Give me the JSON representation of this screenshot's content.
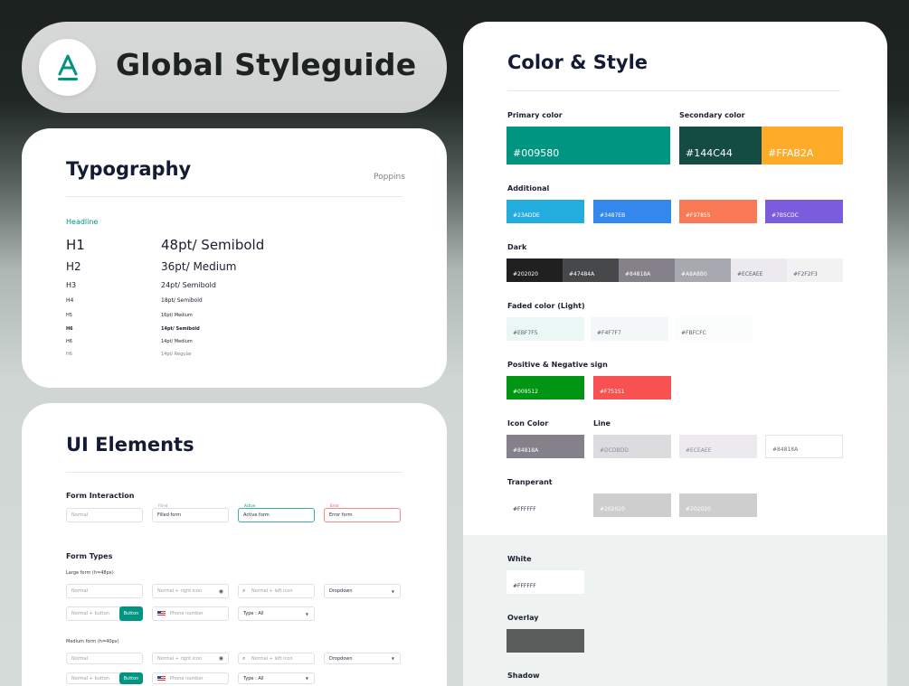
{
  "header": {
    "title": "Global Styleguide",
    "logo_icon": "a-logo-icon",
    "brand_color": "#009580"
  },
  "typography": {
    "title": "Typography",
    "font_name": "Poppins",
    "section_label": "Headline",
    "rows": [
      {
        "tag": "H1",
        "value": "48pt/ Semibold"
      },
      {
        "tag": "H2",
        "value": "36pt/ Medium"
      },
      {
        "tag": "H3",
        "value": "24pt/ Semibold"
      },
      {
        "tag": "H4",
        "value": "18pt/ Semibold"
      },
      {
        "tag": "H5",
        "value": "16pt/ Medium"
      },
      {
        "tag": "H6",
        "value": "14pt/ Semibold"
      },
      {
        "tag": "H6",
        "value": "14pt/ Medium"
      },
      {
        "tag": "H6",
        "value": "14pt/ Regular"
      }
    ]
  },
  "ui_elements": {
    "title": "UI Elements",
    "form_interaction": {
      "label": "Form Interaction",
      "normal": "Normal",
      "filled_caption": "Filled",
      "filled": "Filled form",
      "active_caption": "Active",
      "active": "Active form",
      "error_caption": "Error",
      "error": "Error form"
    },
    "form_types": {
      "label": "Form Types",
      "large_label": "Large form (h=48px)",
      "medium_label": "Medium form (h=40px)",
      "normal": "Normal",
      "normal_right_icon": "Normal + right icon",
      "normal_left_icon": "Normal + left icon",
      "dropdown": "Dropdown",
      "normal_button": "Normal + button",
      "button": "Button",
      "phone": "Phone number",
      "type_all": "Type : All"
    }
  },
  "color_style": {
    "title": "Color & Style",
    "primary": {
      "label": "Primary color",
      "hex": "#009580"
    },
    "secondary": {
      "label": "Secondary color",
      "hex1": "#144C44",
      "hex2": "#FFAB2A"
    },
    "additional": {
      "label": "Additional",
      "colors": [
        "#23ADDE",
        "#3487EB",
        "#F97855",
        "#7B5CDC"
      ]
    },
    "dark": {
      "label": "Dark",
      "colors": [
        "#202020",
        "#47484A",
        "#84818A",
        "#A8A8B0",
        "#ECEAEE",
        "#F2F2F3"
      ]
    },
    "faded": {
      "label": "Faded color (Light)",
      "colors": [
        "#EBF7F5",
        "#F4F7F7",
        "#FBFCFC"
      ]
    },
    "posneg": {
      "label": "Positive & Negative sign",
      "colors": [
        "#009512",
        "#F75151"
      ]
    },
    "icon_color": {
      "label": "Icon Color",
      "hex": "#84818A"
    },
    "line": {
      "label": "Line",
      "colors": [
        "#DCDBDD",
        "#ECEAEE",
        "#84818A"
      ]
    },
    "transparent": {
      "label": "Tranperant",
      "colors": [
        "#FFFFFF",
        "#202020",
        "#202020"
      ]
    },
    "white": {
      "label": "White",
      "hex": "#FFFFFF"
    },
    "overlay": {
      "label": "Overlay"
    },
    "shadow": {
      "label": "Shadow"
    }
  }
}
